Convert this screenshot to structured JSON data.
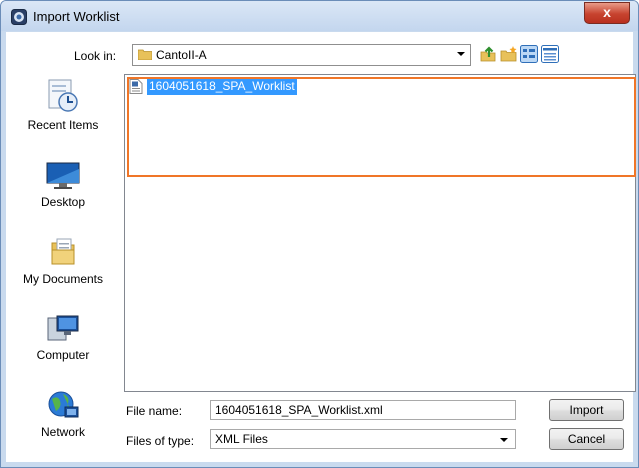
{
  "window": {
    "title": "Import Worklist",
    "close_glyph": "x"
  },
  "toolbar": {
    "lookin_label": "Look in:",
    "lookin_value": "CantoII-A",
    "buttons": [
      "up-folder-icon",
      "new-folder-icon",
      "list-view-icon",
      "details-view-icon"
    ]
  },
  "places": [
    {
      "label": "Recent Items",
      "icon": "recent-items-icon"
    },
    {
      "label": "Desktop",
      "icon": "desktop-icon"
    },
    {
      "label": "My Documents",
      "icon": "my-documents-icon"
    },
    {
      "label": "Computer",
      "icon": "computer-icon"
    },
    {
      "label": "Network",
      "icon": "network-icon"
    }
  ],
  "files": [
    {
      "name": "1604051618_SPA_Worklist",
      "selected": true
    }
  ],
  "form": {
    "file_name_label": "File name:",
    "file_name_value": "1604051618_SPA_Worklist.xml",
    "file_type_label": "Files of type:",
    "file_type_value": "XML Files"
  },
  "buttons": {
    "import": "Import",
    "cancel": "Cancel"
  },
  "colors": {
    "selection": "#3399ff",
    "highlight_box": "#f07628",
    "close_button": "#c7432f"
  }
}
